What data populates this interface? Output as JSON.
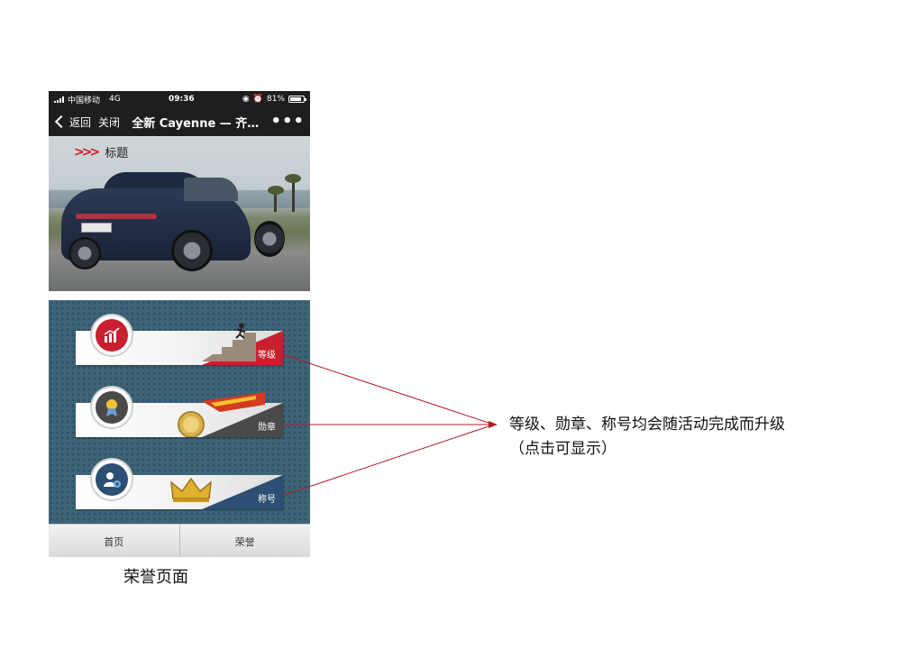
{
  "status_bar": {
    "carrier": "中国移动",
    "network": "4G",
    "time": "09:36",
    "battery": "81%"
  },
  "nav": {
    "back": "返回",
    "close": "关闭",
    "title": "全新 Cayenne — 齐…",
    "more": "•••"
  },
  "hero": {
    "title": "标题"
  },
  "honors": [
    {
      "label": "等级",
      "icon": "level-chart-icon",
      "color": "#c8202e"
    },
    {
      "label": "勋章",
      "icon": "medal-icon",
      "color": "#4a4a4a"
    },
    {
      "label": "称号",
      "icon": "user-gear-icon",
      "color": "#2d4f73"
    }
  ],
  "tabbar": {
    "home": "首页",
    "honor": "荣誉"
  },
  "caption": "荣誉页面",
  "annotation": {
    "line1": "等级、勋章、称号均会随活动完成而升级",
    "line2": "（点击可显示）"
  },
  "colors": {
    "accent": "#d11a2a",
    "honor_bg": "#3e6478",
    "annotation_line": "#b01c2a"
  }
}
